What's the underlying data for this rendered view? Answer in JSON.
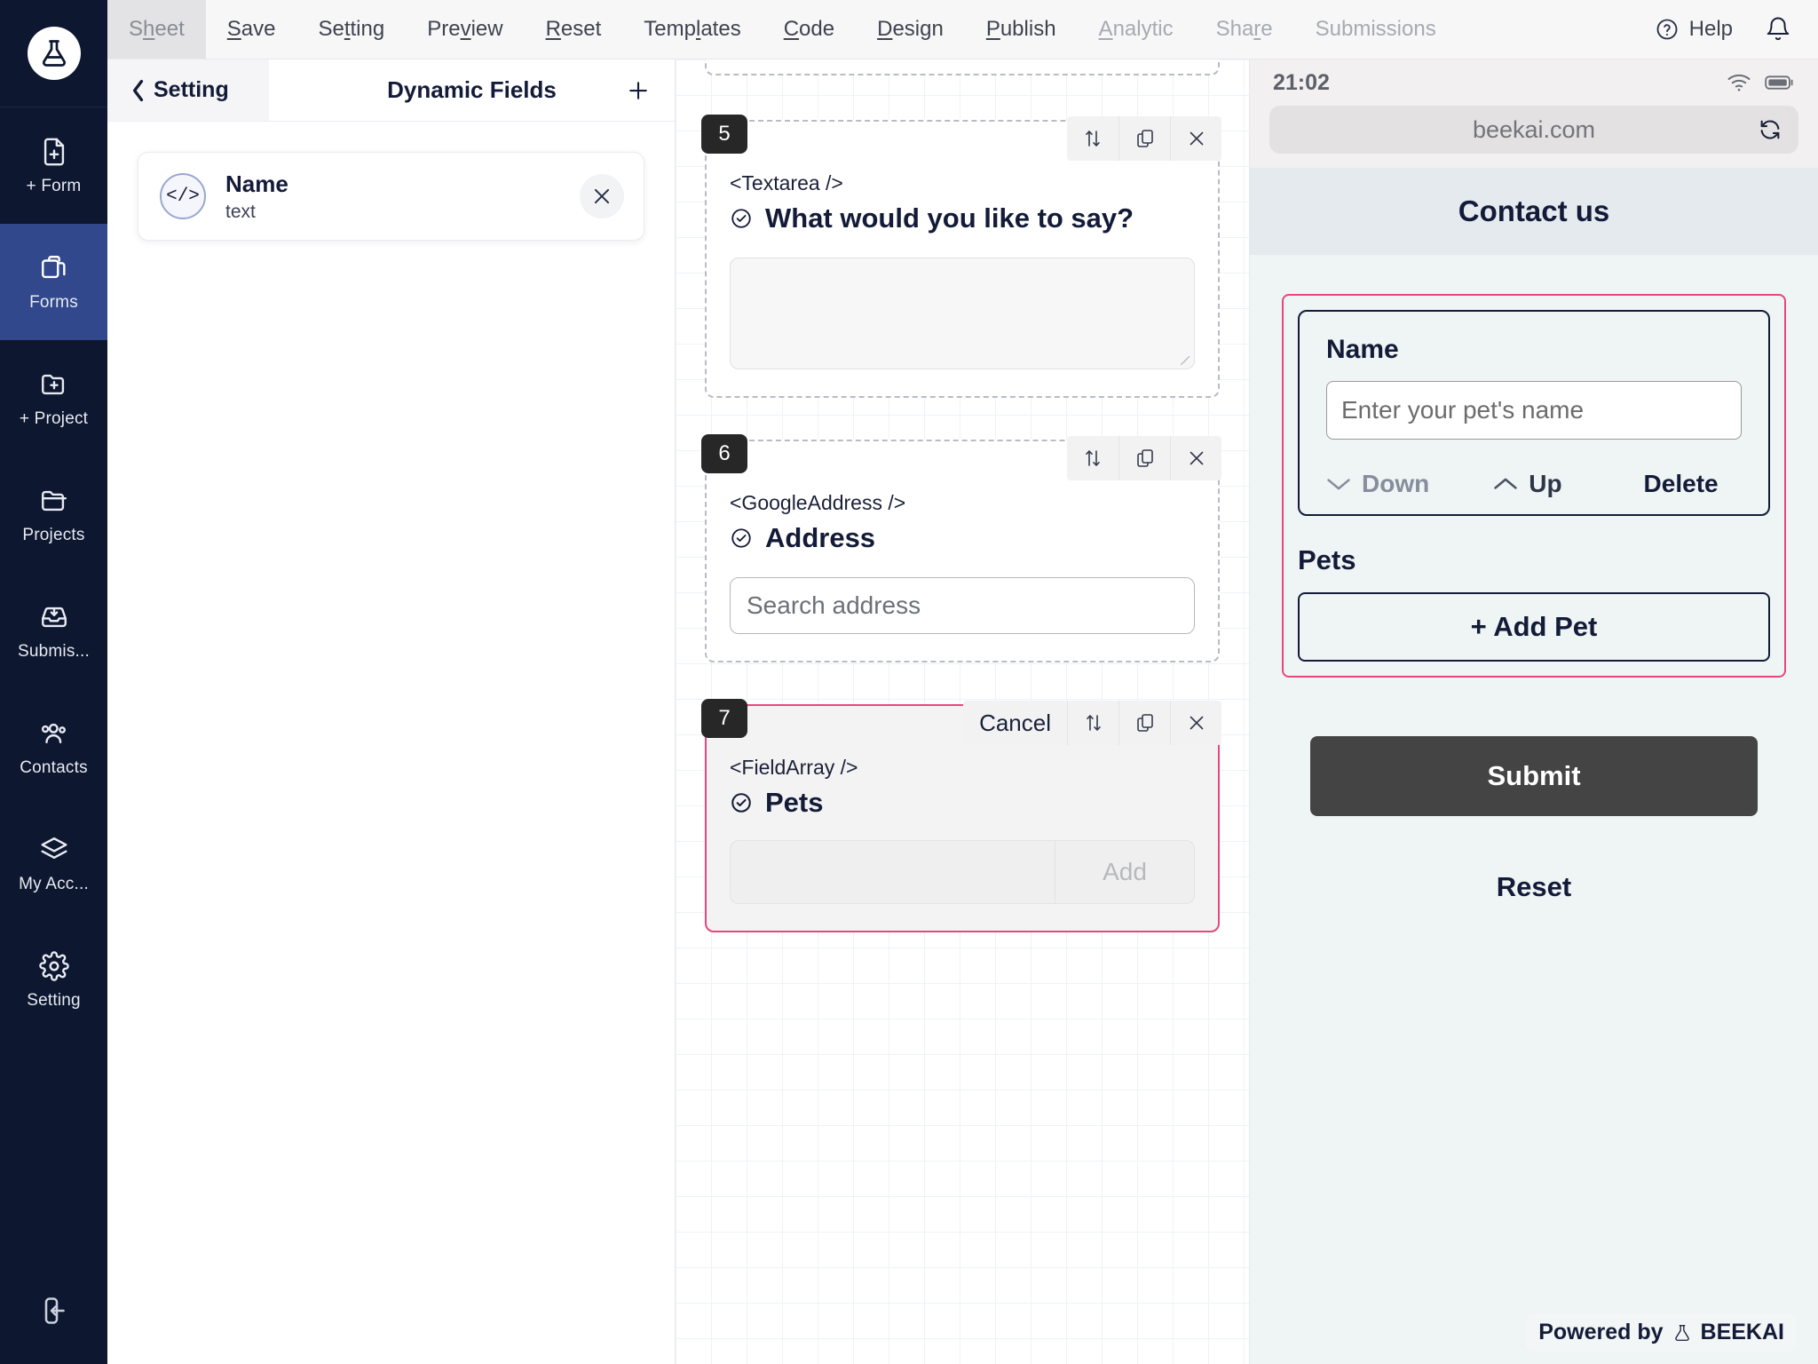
{
  "app": {
    "logo_icon": "beaker-logo-icon"
  },
  "rail": {
    "items": [
      {
        "label": "+ Form",
        "icon": "file-plus-icon",
        "active": false
      },
      {
        "label": "Forms",
        "icon": "clipboard-icon",
        "active": true
      },
      {
        "label": "+ Project",
        "icon": "folder-plus-icon",
        "active": false
      },
      {
        "label": "Projects",
        "icon": "folder-icon",
        "active": false
      },
      {
        "label": "Submis...",
        "icon": "inbox-down-icon",
        "active": false
      },
      {
        "label": "Contacts",
        "icon": "users-icon",
        "active": false
      },
      {
        "label": "My Acc...",
        "icon": "layers-icon",
        "active": false
      },
      {
        "label": "Setting",
        "icon": "gear-icon",
        "active": false
      }
    ],
    "logout_icon": "logout-icon"
  },
  "topnav": {
    "items": [
      {
        "label": "Sheet",
        "accel": "h",
        "state": "selected"
      },
      {
        "label": "Save",
        "accel": "S",
        "state": "normal"
      },
      {
        "label": "Setting",
        "accel": "t",
        "state": "normal"
      },
      {
        "label": "Preview",
        "accel": "v",
        "state": "normal"
      },
      {
        "label": "Reset",
        "accel": "R",
        "state": "normal"
      },
      {
        "label": "Templates",
        "accel": "l",
        "state": "normal"
      },
      {
        "label": "Code",
        "accel": "C",
        "state": "normal"
      },
      {
        "label": "Design",
        "accel": "D",
        "state": "normal"
      },
      {
        "label": "Publish",
        "accel": "P",
        "state": "normal"
      },
      {
        "label": "Analytic",
        "accel": "A",
        "state": "dim"
      },
      {
        "label": "Share",
        "accel": "r",
        "state": "dim"
      },
      {
        "label": "Submissions",
        "accel": "",
        "state": "dim"
      }
    ],
    "help_label": "Help",
    "help_icon": "question-circle-icon",
    "bell_icon": "bell-icon"
  },
  "dynamic_fields": {
    "back_label": "Setting",
    "back_icon": "chevron-left-icon",
    "title": "Dynamic Fields",
    "add_icon": "plus-icon",
    "cards": [
      {
        "name": "Name",
        "type": "text",
        "icon": "code-icon",
        "close_icon": "close-icon"
      }
    ]
  },
  "canvas": {
    "fields": [
      {
        "number": "5",
        "tag": "<Textarea />",
        "label": "What would you like to say?",
        "check_icon": "check-circle-icon",
        "kind": "textarea",
        "active": false,
        "tools": {
          "reorder_icon": "reorder-icon",
          "copy_icon": "copy-icon",
          "close_icon": "close-icon"
        }
      },
      {
        "number": "6",
        "tag": "<GoogleAddress />",
        "label": "Address",
        "check_icon": "check-circle-icon",
        "kind": "input",
        "placeholder": "Search address",
        "active": false,
        "tools": {
          "reorder_icon": "reorder-icon",
          "copy_icon": "copy-icon",
          "close_icon": "close-icon"
        }
      },
      {
        "number": "7",
        "tag": "<FieldArray />",
        "label": "Pets",
        "check_icon": "check-circle-icon",
        "kind": "fieldarray",
        "add_label": "Add",
        "active": true,
        "tools": {
          "cancel_label": "Cancel",
          "reorder_icon": "reorder-icon",
          "copy_icon": "copy-icon",
          "close_icon": "close-icon"
        }
      }
    ]
  },
  "preview": {
    "status_time": "21:02",
    "wifi_icon": "wifi-icon",
    "battery_icon": "battery-icon",
    "url": "beekai.com",
    "reload_icon": "reload-icon",
    "form_title": "Contact us",
    "field_array": {
      "item_label": "Name",
      "item_placeholder": "Enter your pet's name",
      "down_label": "Down",
      "down_icon": "chevron-down-icon",
      "up_label": "Up",
      "up_icon": "chevron-up-icon",
      "delete_label": "Delete",
      "group_label": "Pets",
      "add_label": "+ Add Pet"
    },
    "submit_label": "Submit",
    "reset_label": "Reset",
    "powered_prefix": "Powered by",
    "powered_brand": "BEEKAI",
    "powered_icon": "beaker-logo-icon"
  },
  "colors": {
    "rail_bg": "#0d1730",
    "rail_active": "#31498c",
    "accent_pink": "#e8467c",
    "dark_text": "#131b38",
    "submit_bg": "#444444"
  }
}
